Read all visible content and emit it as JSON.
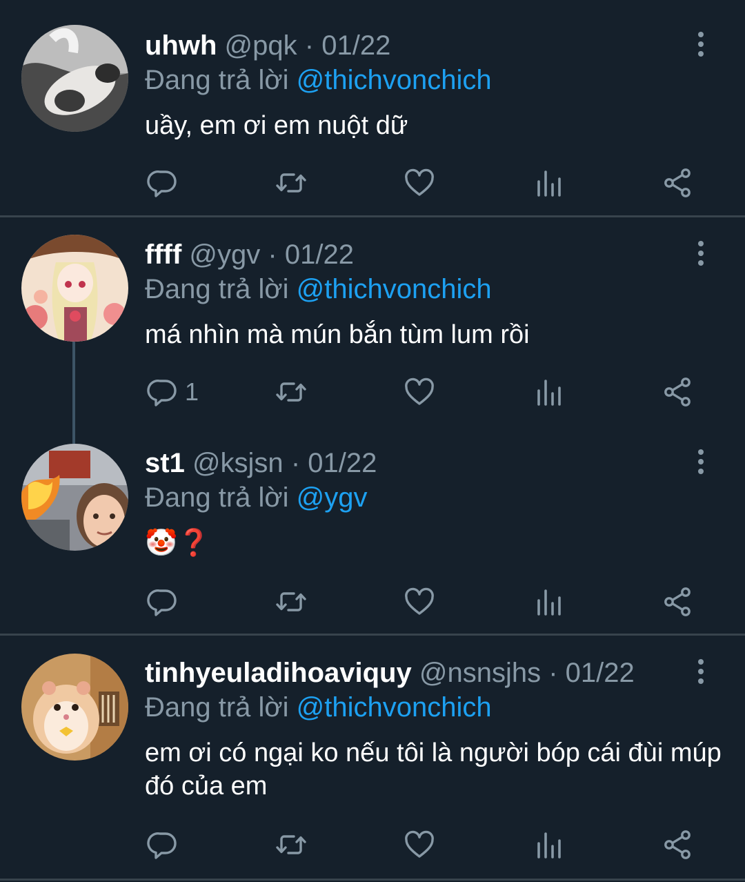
{
  "ui": {
    "reply_prefix": "Đang trả lời"
  },
  "tweets": [
    {
      "name": "uhwh",
      "handle": "@pqk",
      "date": "01/22",
      "reply_to": "@thichvonchich",
      "text": "uầy, em ơi em nuột dữ",
      "reply_count": ""
    },
    {
      "name": "ffff",
      "handle": "@ygv",
      "date": "01/22",
      "reply_to": "@thichvonchich",
      "text": "má nhìn mà mún bắn tùm lum rồi",
      "reply_count": "1"
    },
    {
      "name": "st1",
      "handle": "@ksjsn",
      "date": "01/22",
      "reply_to": "@ygv",
      "text": "🤡❓",
      "reply_count": ""
    },
    {
      "name": "tinhyeuladihoaviquy",
      "handle": "@nsnsjhs",
      "date": "01/22",
      "reply_to": "@thichvonchich",
      "text": "em ơi có ngại ko nếu tôi là người bóp cái đùi múp đó của em",
      "reply_count": ""
    }
  ],
  "icons": {
    "reply": "reply-icon",
    "retweet": "retweet-icon",
    "like": "heart-icon",
    "analytics": "analytics-icon",
    "share": "share-icon",
    "more": "more-vertical-icon"
  },
  "colors": {
    "background": "#15202b",
    "secondary_text": "#8899a6",
    "mention": "#1da1f2",
    "divider": "#38444d",
    "thread_line": "#3d5466",
    "icon": "#8899a6"
  }
}
